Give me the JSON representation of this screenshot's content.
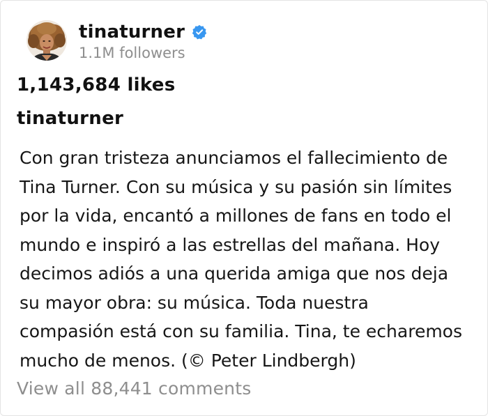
{
  "post": {
    "username": "tinaturner",
    "followers": "1.1M followers",
    "likes": "1,143,684 likes",
    "caption_username": "tinaturner",
    "caption_text": "Con gran tristeza anunciamos el fallecimiento de\nTina Turner.  Con su música y su pasión sin límites\npor la vida, encantó a millones de fans en todo el\nmundo e inspiró a las estrellas del mañana. Hoy\ndecimos adiós a una querida amiga que nos deja\nsu mayor obra: su música. Toda nuestra\ncompasión está con su familia. Tina, te echaremos\nmucho de menos. (© Peter Lindbergh)",
    "view_comments": "View all 88,441 comments"
  },
  "icons": {
    "avatar": "profile-photo",
    "verified": "verified-badge-icon"
  },
  "colors": {
    "verified_blue": "#3897f0",
    "secondary_text": "#8e8e8e",
    "primary_text": "#111111"
  }
}
